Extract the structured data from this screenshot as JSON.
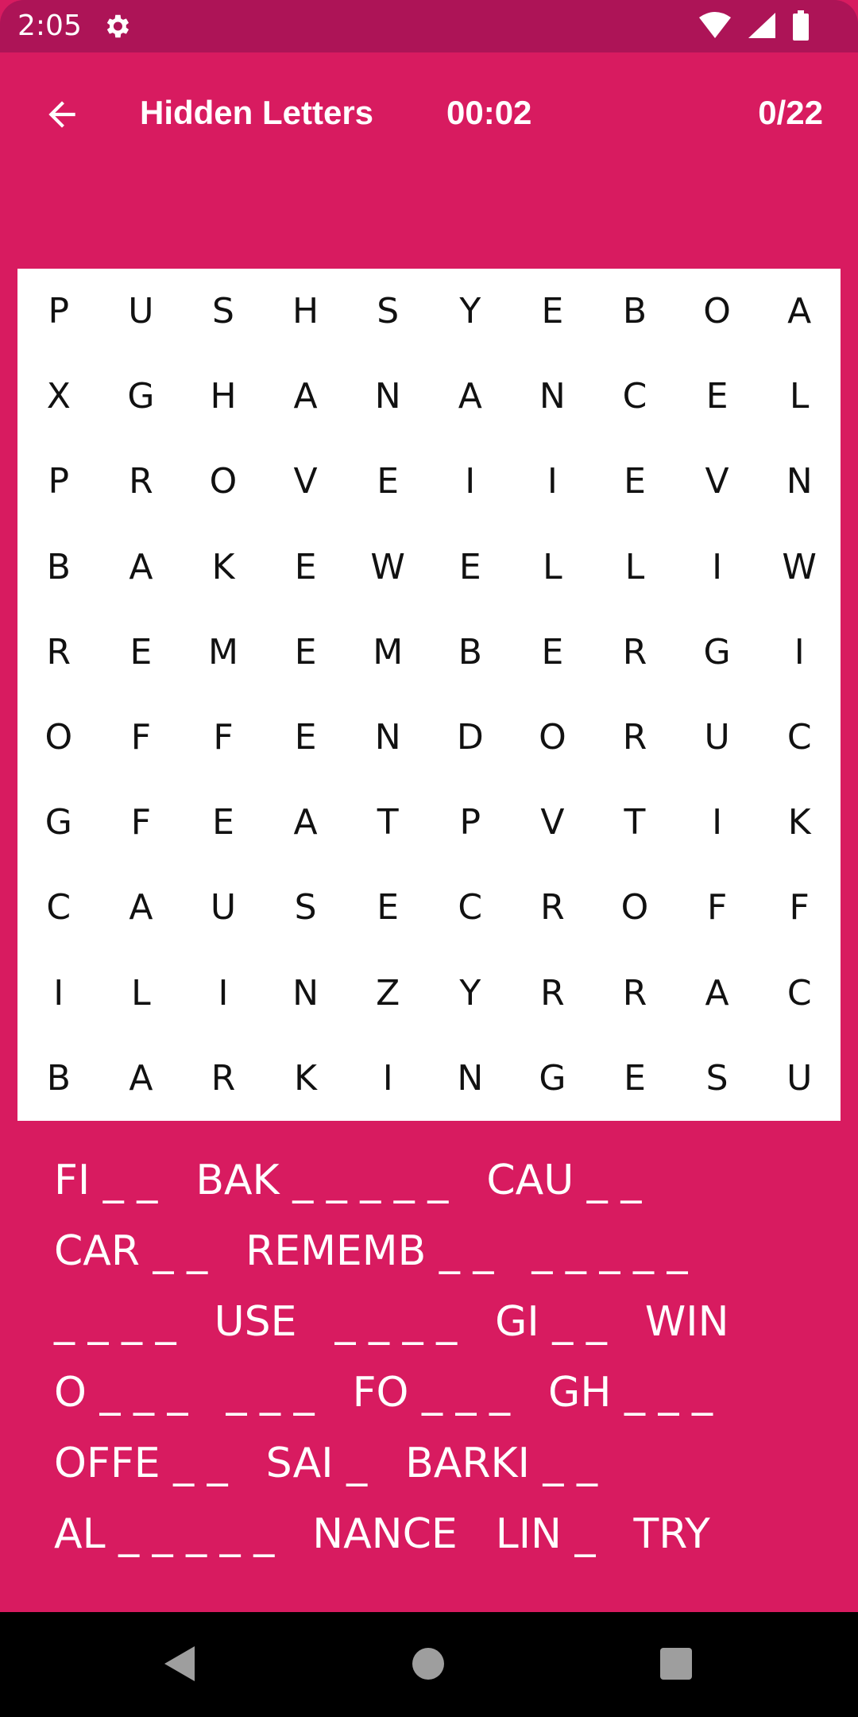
{
  "status_bar": {
    "time": "2:05",
    "icons": [
      "settings-icon",
      "wifi-icon",
      "signal-icon",
      "battery-icon"
    ]
  },
  "app_bar": {
    "back_icon": "arrow-back-icon",
    "title": "Hidden Letters",
    "timer": "00:02",
    "score": "0/22"
  },
  "grid": {
    "rows": [
      [
        "P",
        "U",
        "S",
        "H",
        "S",
        "Y",
        "E",
        "B",
        "O",
        "A"
      ],
      [
        "X",
        "G",
        "H",
        "A",
        "N",
        "A",
        "N",
        "C",
        "E",
        "L"
      ],
      [
        "P",
        "R",
        "O",
        "V",
        "E",
        "I",
        "I",
        "E",
        "V",
        "N"
      ],
      [
        "B",
        "A",
        "K",
        "E",
        "W",
        "E",
        "L",
        "L",
        "I",
        "W"
      ],
      [
        "R",
        "E",
        "M",
        "E",
        "M",
        "B",
        "E",
        "R",
        "G",
        "I"
      ],
      [
        "O",
        "F",
        "F",
        "E",
        "N",
        "D",
        "O",
        "R",
        "U",
        "C"
      ],
      [
        "G",
        "F",
        "E",
        "A",
        "T",
        "P",
        "V",
        "T",
        "I",
        "K"
      ],
      [
        "C",
        "A",
        "U",
        "S",
        "E",
        "C",
        "R",
        "O",
        "F",
        "F"
      ],
      [
        "I",
        "L",
        "I",
        "N",
        "Z",
        "Y",
        "R",
        "R",
        "A",
        "C"
      ],
      [
        "B",
        "A",
        "R",
        "K",
        "I",
        "N",
        "G",
        "E",
        "S",
        "U"
      ]
    ]
  },
  "words": {
    "rows": [
      [
        "FI _ _",
        "BAK _ _ _ _ _",
        "CAU _ _"
      ],
      [
        "CAR _ _",
        "REMEMB _ _",
        "_ _ _ _ _"
      ],
      [
        "_ _ _ _",
        "USE",
        "_ _ _ _",
        "GI _ _",
        "WIN"
      ],
      [
        "O _ _ _",
        "_ _ _",
        "FO _ _ _",
        "GH _ _ _"
      ],
      [
        "OFFE _ _",
        "SAI _",
        "BARKI _ _"
      ],
      [
        "AL _ _ _ _ _",
        "NANCE",
        "LIN _",
        "TRY"
      ]
    ]
  },
  "colors": {
    "primary": "#d81b60",
    "status_bar": "#ad1457",
    "grid_background": "#ffffff",
    "nav_bar": "#000000"
  },
  "nav_bar": {
    "buttons": [
      "back-triangle-icon",
      "home-circle-icon",
      "recents-square-icon"
    ]
  }
}
